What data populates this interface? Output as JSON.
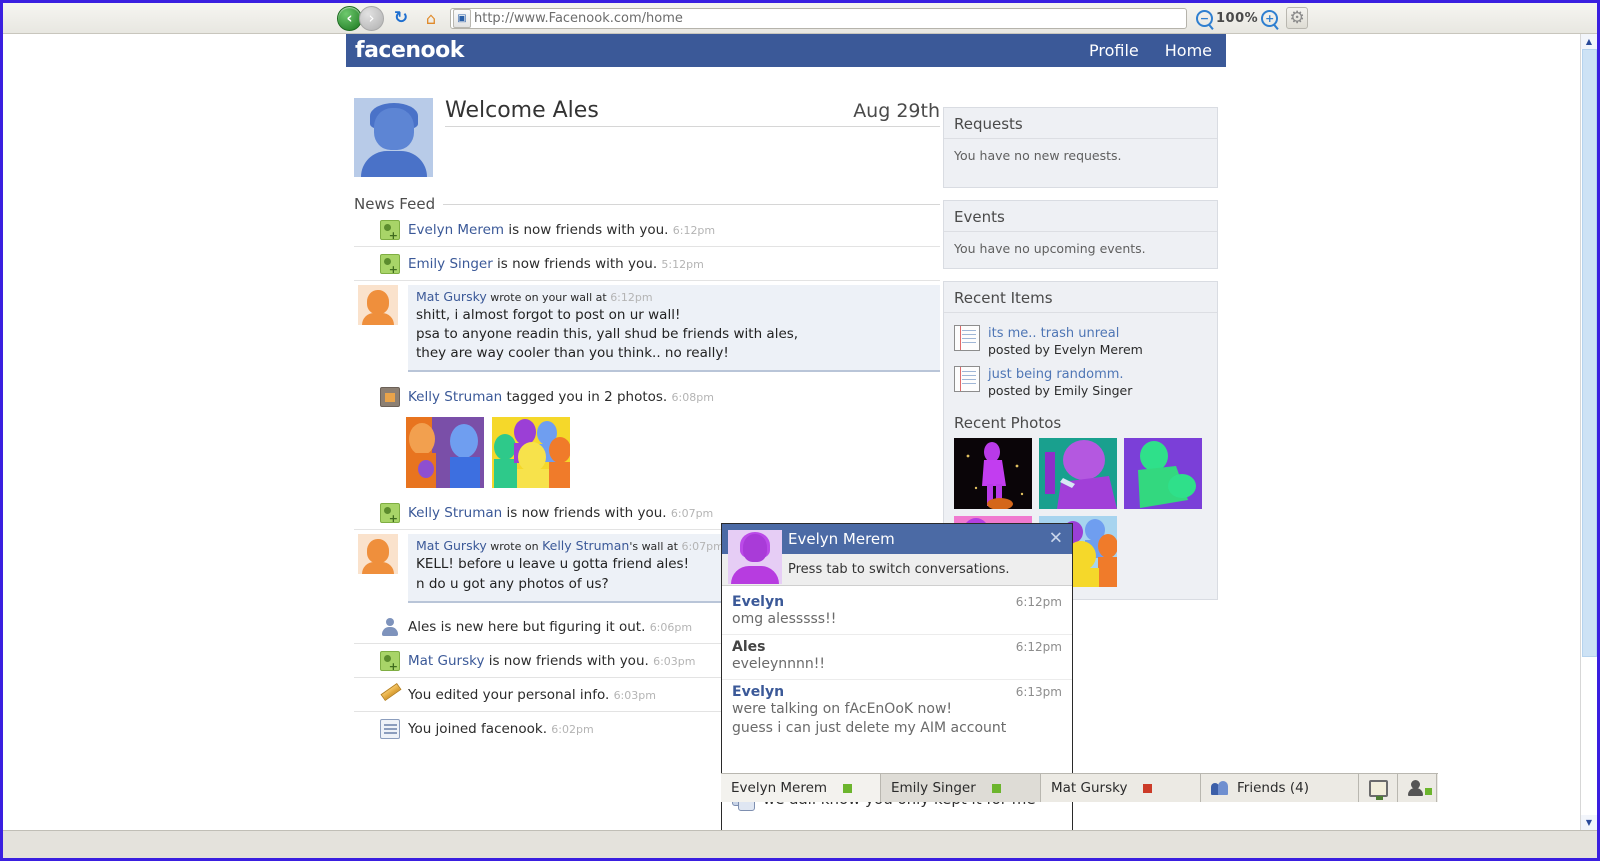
{
  "browser": {
    "url": "http://www.Facenook.com/home",
    "zoom_level": "100%",
    "back_label": "‹",
    "forward_label": "›",
    "reload_label": "↻",
    "home_label": "⌂",
    "site_icon_label": "▣",
    "zoom_out_label": "−",
    "zoom_in_label": "+",
    "gear_label": "⚙",
    "scroll_up_label": "▲",
    "scroll_down_label": "▼"
  },
  "site": {
    "logo": "facenook",
    "nav": [
      {
        "label": "Profile"
      },
      {
        "label": "Home"
      }
    ]
  },
  "profile": {
    "welcome": "Welcome Ales",
    "date": "Aug 29th"
  },
  "news_feed": {
    "label": "News Feed",
    "items": [
      {
        "type": "friend",
        "icon": "friend-add-icon",
        "person": "Evelyn Merem",
        "text": " is now friends with you.",
        "time": "6:12pm"
      },
      {
        "type": "friend",
        "icon": "friend-add-icon",
        "person": "Emily Singer",
        "text": " is now friends with you.",
        "time": "5:12pm"
      },
      {
        "type": "wall",
        "icon": "avatar-orange",
        "person": "Mat Gursky",
        "meta_mid": " wrote on your wall at ",
        "time": "6:12pm",
        "lines": [
          "shitt, i almost forgot to post on ur wall!",
          "psa to anyone readin this, yall shud be friends with ales,",
          "they are way cooler than you think.. no really!"
        ]
      },
      {
        "type": "tagged",
        "icon": "photo-tag-icon",
        "person": "Kelly Struman",
        "text": " tagged you in 2 photos.",
        "time": "6:08pm",
        "photos": [
          "photo-two-people",
          "photo-group-yellow"
        ]
      },
      {
        "type": "friend",
        "icon": "friend-add-icon",
        "person": "Kelly Struman",
        "text": " is now friends with you.",
        "time": "6:07pm"
      },
      {
        "type": "wall",
        "icon": "avatar-orange",
        "person": "Mat Gursky",
        "meta_mid": " wrote on ",
        "person2": "Kelly Struman",
        "meta_tail": "'s wall at ",
        "time": "6:07pm",
        "lines": [
          "KELL! before u leave u gotta friend ales!",
          "n do u got any photos of us?"
        ]
      },
      {
        "type": "plain",
        "icon": "person-icon",
        "text": "Ales is new here but figuring it out.",
        "time": "6:06pm"
      },
      {
        "type": "friend",
        "icon": "friend-add-icon",
        "person": "Mat Gursky",
        "text": " is now friends with you.",
        "time": "6:03pm"
      },
      {
        "type": "plain",
        "icon": "pencil-icon",
        "text": "You edited your personal info.",
        "time": "6:03pm"
      },
      {
        "type": "plain",
        "icon": "note-icon",
        "text": "You joined facenook.",
        "time": "6:02pm"
      }
    ]
  },
  "sidebar": {
    "requests": {
      "title": "Requests",
      "body": "You have no new requests."
    },
    "events": {
      "title": "Events",
      "body": "You have no upcoming events."
    },
    "recent_items": {
      "title": "Recent Items",
      "items": [
        {
          "link": "its me.. trash unreal",
          "sub": "posted by Evelyn Merem"
        },
        {
          "link": "just being randomm.",
          "sub": "posted by Emily Singer"
        }
      ]
    },
    "recent_photos": {
      "title": "Recent Photos",
      "photos": [
        "photo-night-purple",
        "photo-teal-purple",
        "photo-green-purple",
        "photo-pink-green",
        "photo-group-blue",
        "photo-hidden"
      ]
    }
  },
  "chat": {
    "title": "Evelyn Merem",
    "close_label": "✕",
    "hint": "Press tab to switch conversations.",
    "messages": [
      {
        "sender": "Evelyn",
        "is_me": false,
        "time": "6:12pm",
        "lines": [
          "omg alesssss!!"
        ]
      },
      {
        "sender": "Ales",
        "is_me": true,
        "time": "6:12pm",
        "lines": [
          "eveleynnnn!!"
        ]
      },
      {
        "sender": "Evelyn",
        "is_me": false,
        "time": "6:13pm",
        "lines": [
          "were talking on fAcEnOoK now!",
          "guess i can just delete my AIM account"
        ]
      }
    ],
    "input_text": "we aall know you only kept it for me"
  },
  "taskbar": {
    "tabs": [
      {
        "label": "Evelyn Merem",
        "status": "green",
        "active": false
      },
      {
        "label": "Emily Singer",
        "status": "green",
        "active": true
      },
      {
        "label": "Mat Gursky",
        "status": "red",
        "active": false
      }
    ],
    "friends": {
      "label": "Friends (4)"
    },
    "buttons": [
      {
        "icon": "monitor-icon"
      },
      {
        "icon": "contact-icon"
      }
    ]
  },
  "colors": {
    "fb_blue": "#3b5998",
    "chat_title_blue": "#4b6aa5",
    "status_green": "#6cb52d",
    "status_red": "#cc3b28",
    "link_blue": "#4f76b5"
  }
}
